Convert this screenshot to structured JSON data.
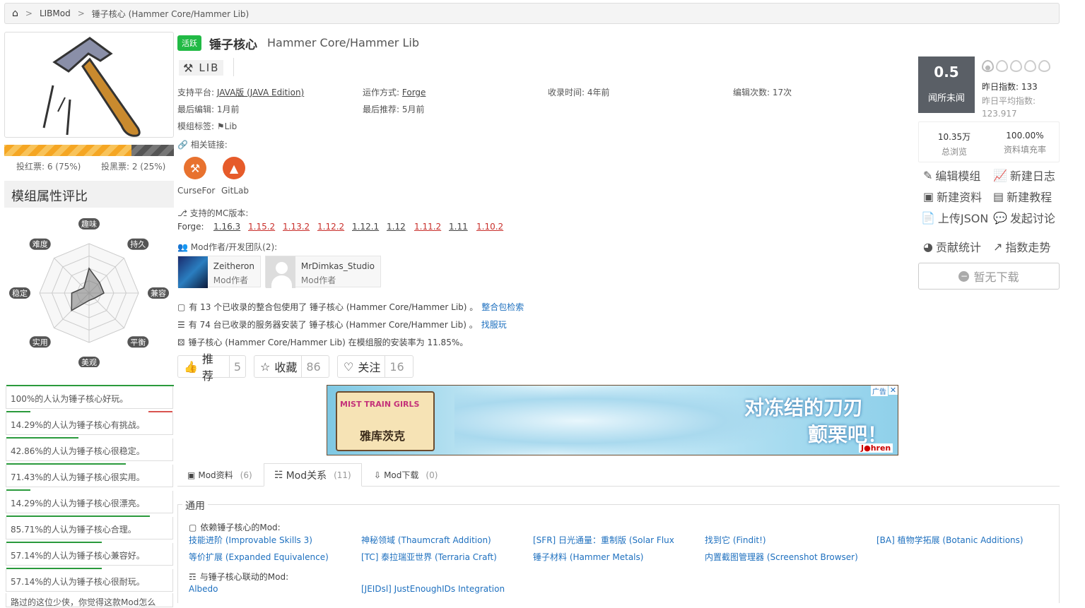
{
  "breadcrumb": {
    "home_icon": "home-icon",
    "items": [
      "LIBMod",
      "锤子核心 (Hammer Core/Hammer Lib)"
    ]
  },
  "cover": {
    "alt": "hammer-and-nails-icon"
  },
  "votes": {
    "red": "投红票: 6 (75%)",
    "black": "投黑票: 2 (25%)",
    "red_fraction": 0.75
  },
  "attr": {
    "title": "模组属性评比",
    "axes": [
      "趣味",
      "持久",
      "兼容",
      "平衡",
      "美观",
      "实用",
      "稳定",
      "难度"
    ],
    "values": [
      0.5,
      0.3,
      0.3,
      0.15,
      0.15,
      0.5,
      0.35,
      0.15
    ]
  },
  "opinions": [
    {
      "text": "100%的人认为锤子核心好玩。",
      "pct": 100,
      "neg": 0
    },
    {
      "text": "14.29%的人认为锤子核心有挑战。",
      "pct": 14.29,
      "neg": 14.29
    },
    {
      "text": "42.86%的人认为锤子核心很稳定。",
      "pct": 42.86,
      "neg": 0
    },
    {
      "text": "71.43%的人认为锤子核心很实用。",
      "pct": 71.43,
      "neg": 0
    },
    {
      "text": "14.29%的人认为锤子核心很漂亮。",
      "pct": 14.29,
      "neg": 0
    },
    {
      "text": "85.71%的人认为锤子核心合理。",
      "pct": 85.71,
      "neg": 0
    },
    {
      "text": "57.14%的人认为锤子核心兼容好。",
      "pct": 57.14,
      "neg": 0
    },
    {
      "text": "57.14%的人认为锤子核心很耐玩。",
      "pct": 57.14,
      "neg": 0
    }
  ],
  "opinion_more": "路过的这位少侠，你觉得这款Mod怎么",
  "header": {
    "badge": "活跃",
    "title": "锤子核心",
    "subtitle": "Hammer Core/Hammer Lib",
    "tag": "LIB"
  },
  "info": {
    "platform_label": "支持平台:",
    "platform": "JAVA版 (JAVA Edition)",
    "run_label": "运作方式:",
    "run": "Forge",
    "added_label": "收录时间:",
    "added": "4年前",
    "edits_label": "编辑次数:",
    "edits": "17次",
    "lastedit_label": "最后编辑:",
    "lastedit": "1月前",
    "lastrec_label": "最后推荐:",
    "lastrec": "5月前",
    "tags_label": "模组标签:",
    "tag": "Lib",
    "links_label": "相关链接:"
  },
  "links": [
    {
      "name": "CurseFor",
      "color": "#e8722f"
    },
    {
      "name": "GitLab",
      "color": "#e65b2a"
    }
  ],
  "mc": {
    "label": "支持的MC版本:",
    "loader": "Forge:",
    "versions": [
      {
        "v": "1.16.3",
        "red": false
      },
      {
        "v": "1.15.2",
        "red": true
      },
      {
        "v": "1.13.2",
        "red": true
      },
      {
        "v": "1.12.2",
        "red": true
      },
      {
        "v": "1.12.1",
        "red": false
      },
      {
        "v": "1.12",
        "red": false
      },
      {
        "v": "1.11.2",
        "red": true
      },
      {
        "v": "1.11",
        "red": false
      },
      {
        "v": "1.10.2",
        "red": true
      }
    ]
  },
  "authors": {
    "label": "Mod作者/开发团队(2):",
    "list": [
      {
        "name": "Zeitheron",
        "role": "Mod作者"
      },
      {
        "name": "MrDimkas_Studio",
        "role": "Mod作者"
      }
    ]
  },
  "usage": {
    "modpack": "有 13 个已收录的整合包使用了 锤子核心 (Hammer Core/Hammer Lib) 。",
    "modpack_link": "整合包检索",
    "server": "有 74 台已收录的服务器安装了 锤子核心 (Hammer Core/Hammer Lib) 。",
    "server_link": "找服玩",
    "rate": "锤子核心 (Hammer Core/Hammer Lib) 在模组服的安装率为 11.85%。"
  },
  "buttons": {
    "recommend": "推荐",
    "recommend_n": "5",
    "fav": "收藏",
    "fav_n": "86",
    "follow": "关注",
    "follow_n": "16"
  },
  "ad": {
    "left_title": "MIST TRAIN GIRLS",
    "left_sub": "雅库茨克",
    "right1": "对冻结的刀刃",
    "right2": "颤栗吧！",
    "badge": "广告",
    "brand": "J●hren"
  },
  "tabs": [
    {
      "label": "Mod资料",
      "n": "(6)"
    },
    {
      "label": "Mod关系",
      "n": "(11)"
    },
    {
      "label": "Mod下载",
      "n": "(0)"
    }
  ],
  "relations": {
    "general": "通用",
    "depend_label": "依赖锤子核心的Mod:",
    "depend": [
      "技能进阶 (Improvable Skills 3)",
      "神秘领域 (Thaumcraft Addition)",
      "[SFR] 日光通量：重制版 (Solar Flux",
      "找到它 (Findit!)",
      "[BA] 植物学拓展 (Botanic Additions)",
      "等价扩展 (Expanded Equivalence)",
      "[TC] 泰拉瑞亚世界 (Terraria Craft)",
      "锤子材料 (Hammer Metals)",
      "内置截图管理器 (Screenshot Browser)"
    ],
    "link_label": "与锤子核心联动的Mod:",
    "linked": [
      "Albedo",
      "[JEIDsl] JustEnoughIDs Integration"
    ]
  },
  "score": {
    "value": "0.5",
    "label": "闻所未闻",
    "yesterday": "昨日指数: 133",
    "avg_label": "昨日平均指数:",
    "avg": "123.917"
  },
  "stats": {
    "views": "10.35万",
    "views_label": "总浏览",
    "fill": "100.00%",
    "fill_label": "资料填充率"
  },
  "actions": [
    "编辑模组",
    "新建日志",
    "新建资料",
    "新建教程",
    "上传JSON",
    "发起讨论",
    "贡献统计",
    "指数走势"
  ],
  "download": "暂无下载"
}
